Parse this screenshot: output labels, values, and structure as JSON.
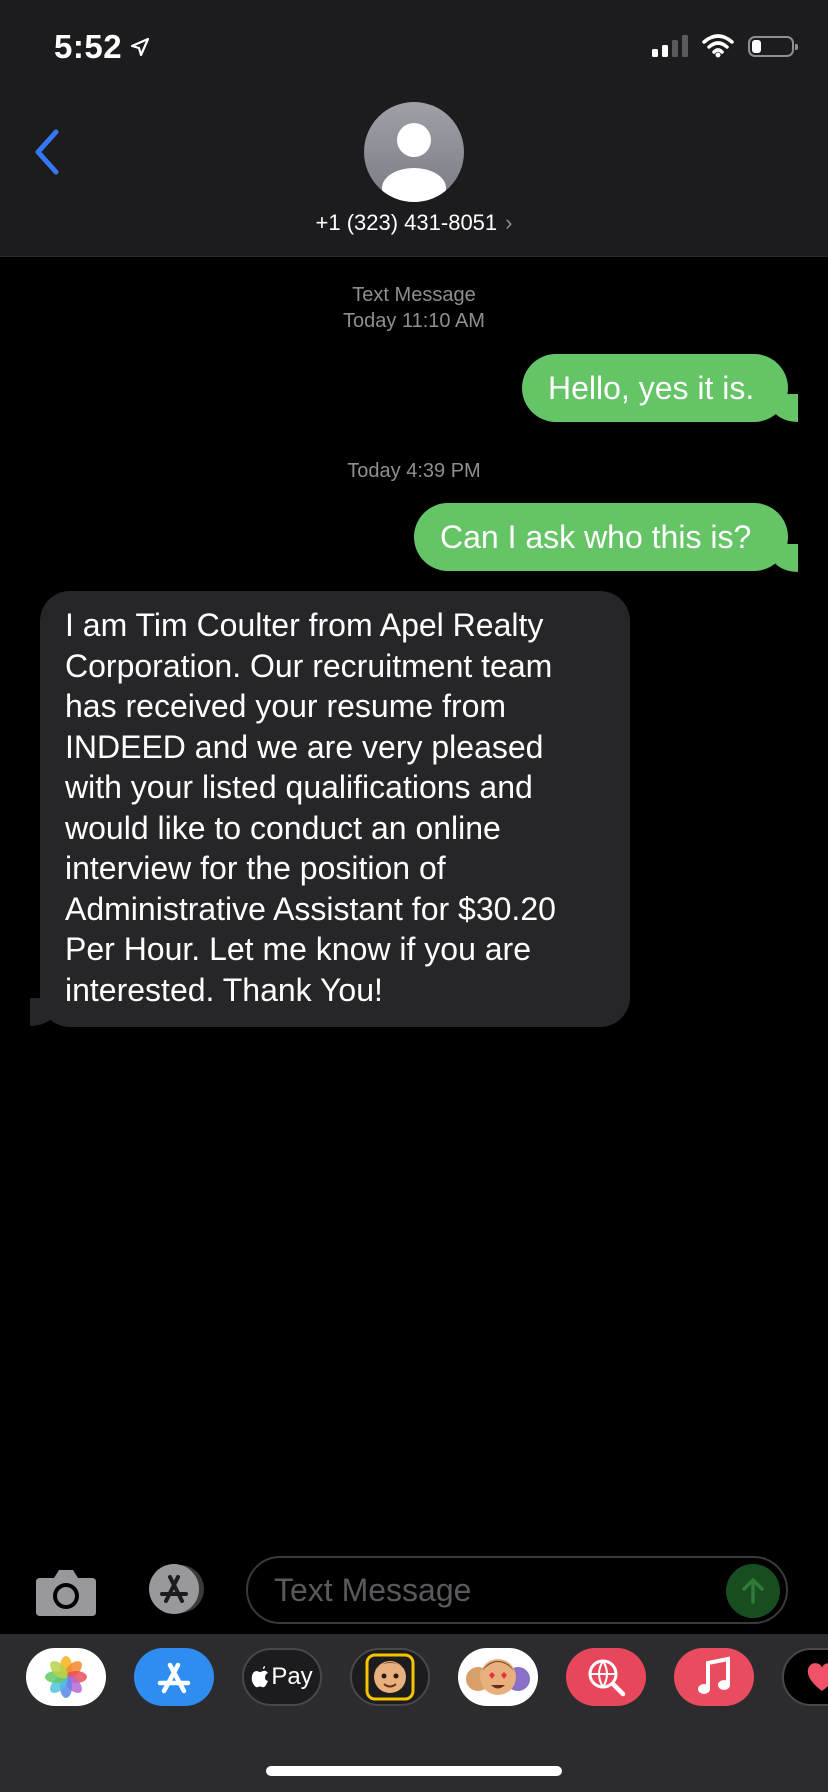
{
  "status_bar": {
    "time": "5:52"
  },
  "header": {
    "contact": "+1 (323) 431-8051"
  },
  "messages": {
    "stamp1_line1": "Text Message",
    "stamp1_line2": "Today 11:10 AM",
    "out1": "Hello, yes it is.",
    "stamp2": "Today 4:39 PM",
    "out2": "Can I ask who this is?",
    "in1_lines": [
      "I am Tim Coulter from Apel Realty",
      "Corporation. Our recruitment team",
      "has received your resume from",
      "INDEED and we are very pleased",
      "with your listed qualifications and",
      "would like to conduct an online",
      "interview for the position of",
      "Administrative Assistant for $30.20",
      "Per Hour. Let me know if you are",
      "interested. Thank You!"
    ]
  },
  "input": {
    "placeholder": "Text Message"
  },
  "drawer": {
    "apple_pay_label": "Pay"
  },
  "colors": {
    "outgoing": "#65c466",
    "incoming": "#262628",
    "accent": "#3478f6"
  }
}
